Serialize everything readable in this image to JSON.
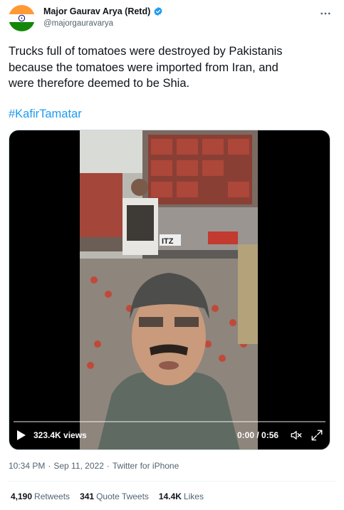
{
  "author": {
    "display_name": "Major Gaurav Arya (Retd)",
    "handle": "@majorgauravarya",
    "verified": true,
    "avatar_icon": "india-flag-avatar"
  },
  "tweet": {
    "text": "Trucks full of tomatoes were destroyed by Pakistanis\nbecause the tomatoes were imported from Iran, and\nwere therefore deemed to be Shia.",
    "hashtag": "#KafirTamatar"
  },
  "video": {
    "truck_plate": "ITZ",
    "views": "323.4K views",
    "time": "0:00 / 0:56"
  },
  "meta": {
    "time": "10:34 PM",
    "date": "Sep 11, 2022",
    "separator": "·",
    "source": "Twitter for iPhone"
  },
  "stats": {
    "retweets_count": "4,190",
    "retweets_label": "Retweets",
    "quotes_count": "341",
    "quotes_label": "Quote Tweets",
    "likes_count": "14.4K",
    "likes_label": "Likes"
  },
  "colors": {
    "accent": "#1d9bf0",
    "text": "#0f1419",
    "secondary": "#536471"
  }
}
